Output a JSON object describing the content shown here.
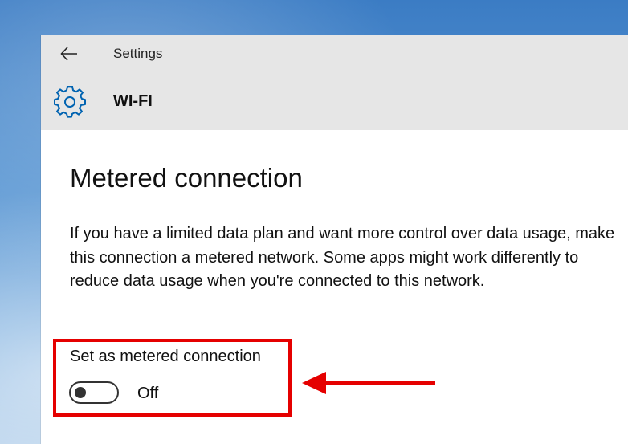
{
  "window": {
    "app_title": "Settings",
    "page_heading": "WI-FI"
  },
  "icons": {
    "back": "back-arrow-icon",
    "settings": "gear-icon"
  },
  "content": {
    "section_title": "Metered connection",
    "description": "If you have a limited data plan and want more control over data usage, make this connection a metered network. Some apps might work differently to reduce data usage when you're connected to this network.",
    "setting_label": "Set as metered connection",
    "toggle_state": "Off",
    "toggle_on": false
  },
  "colors": {
    "titlebar": "#e6e6e6",
    "annotation_red": "#e50000",
    "accent_blue": "#0063b1"
  }
}
